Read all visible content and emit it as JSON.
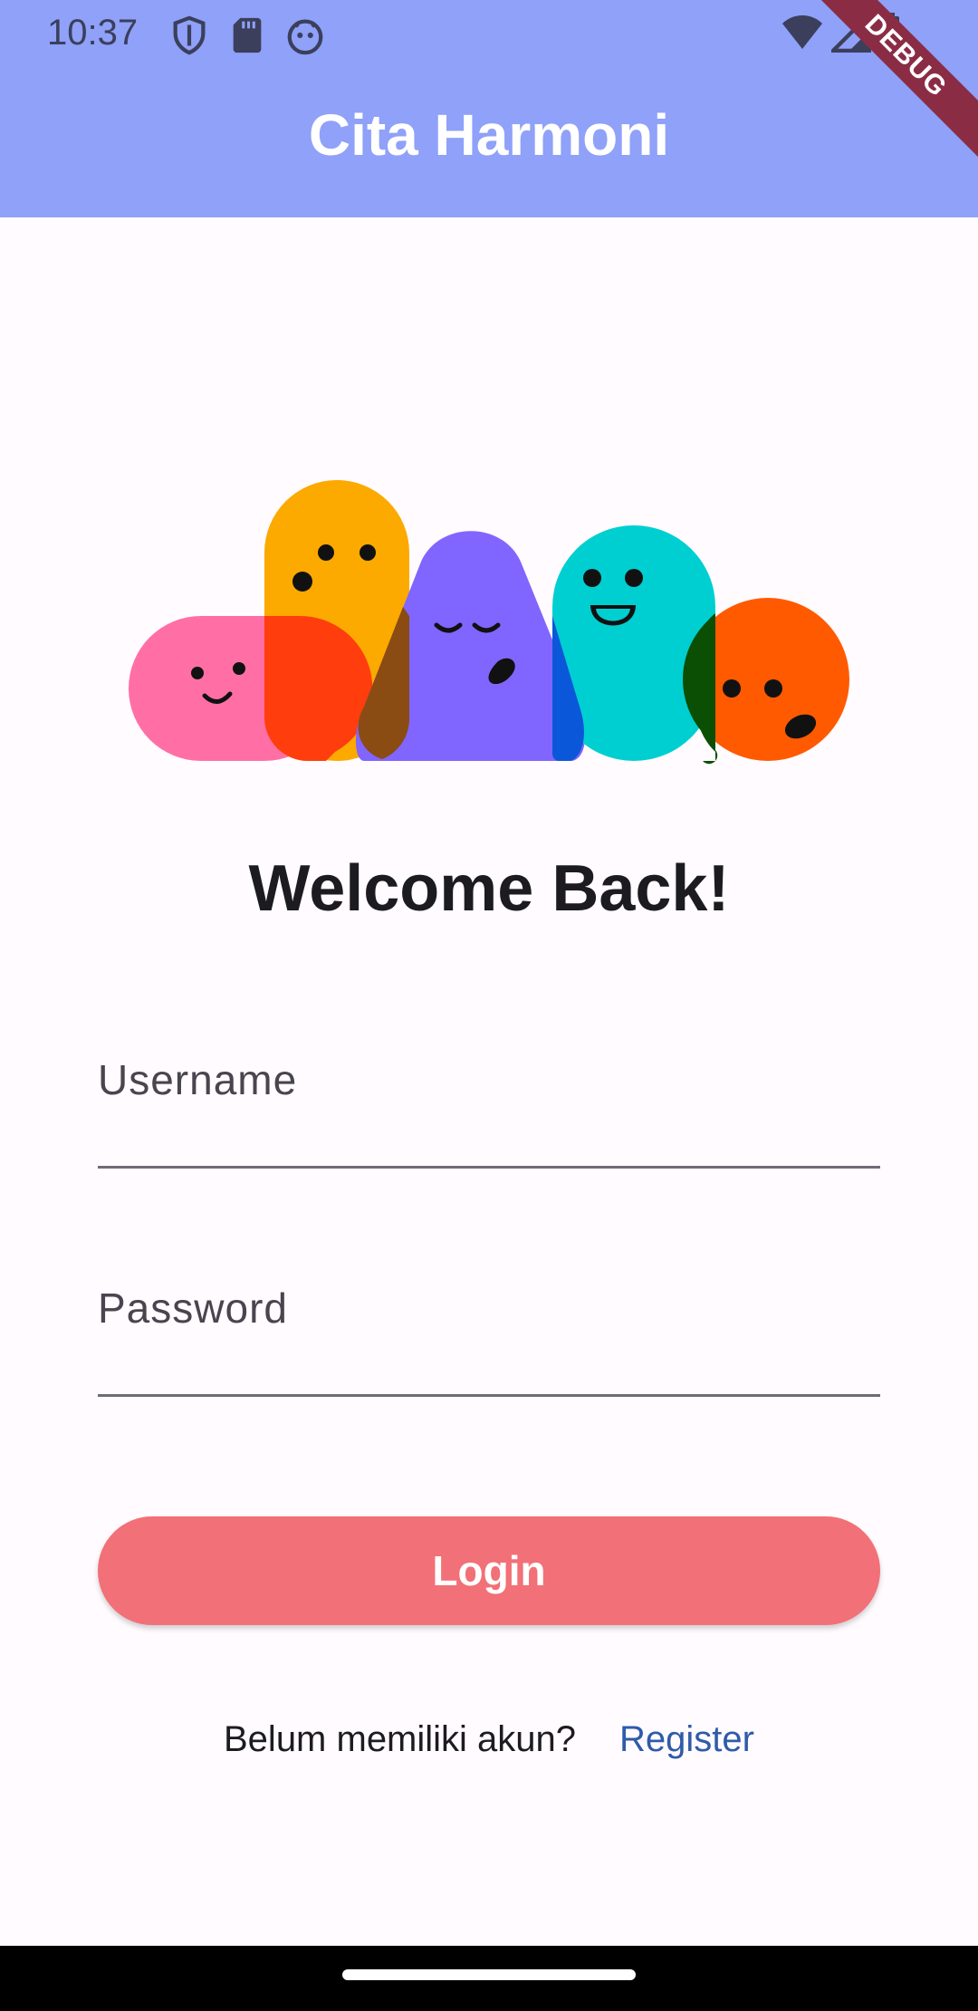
{
  "status_bar": {
    "time": "10:37",
    "left_icons": [
      "shield-icon",
      "sd-card-icon",
      "android-face-icon"
    ],
    "right_icons": [
      "wifi-icon",
      "signal-icon",
      "battery-icon"
    ]
  },
  "app_bar": {
    "title": "Cita Harmoni",
    "background": "#8fa1f8",
    "debug_banner": "DEBUG"
  },
  "illustration": {
    "name": "colorful-blob-characters"
  },
  "welcome": {
    "heading": "Welcome Back!"
  },
  "form": {
    "username_label": "Username",
    "username_value": "",
    "password_label": "Password",
    "password_value": ""
  },
  "login_button": {
    "label": "Login",
    "color": "#f27077"
  },
  "register": {
    "prompt": "Belum memiliki akun?",
    "link_label": "Register",
    "link_color": "#2f5ba8"
  }
}
